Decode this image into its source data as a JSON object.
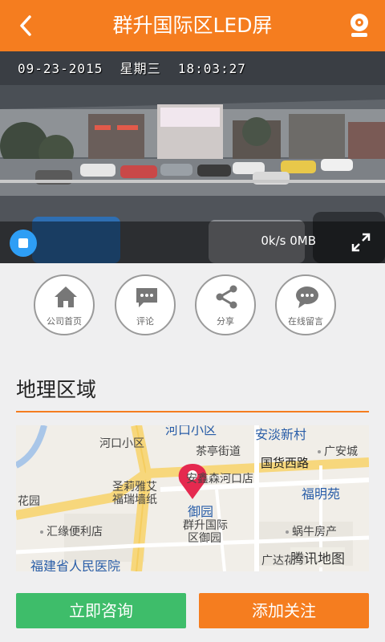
{
  "header": {
    "title": "群升国际区LED屏"
  },
  "video": {
    "timestamp": "09-23-2015  星期三  18:03:27",
    "speed": "0k/s 0MB"
  },
  "actions": [
    {
      "label": "公司首页",
      "icon": "home-icon"
    },
    {
      "label": "评论",
      "icon": "comment-icon"
    },
    {
      "label": "分享",
      "icon": "share-icon"
    },
    {
      "label": "在线留言",
      "icon": "message-icon"
    }
  ],
  "section": {
    "title": "地理区域"
  },
  "map": {
    "labels": {
      "hekou_area_top": "河口小区",
      "anhuai": "安淡新村",
      "hekou_area": "河口小区",
      "chating": "茶亭街道",
      "guangan": "广安城",
      "guohuo": "国货西路",
      "shengli": "圣莉雅艾",
      "fuxiang": "福瑞墙纸",
      "anxin": "安鑫森河口店",
      "fumingyuan": "福明苑",
      "huayuan": "花园",
      "yuyuan": "御园",
      "qunsheng": "群升国际",
      "qunsheng2": "区御园",
      "wonuifang": "蜗牛房产",
      "huijian": "汇缘便利店",
      "guangda": "广达花园",
      "hospital": "福建省人民医院",
      "tencent": "腾讯地图"
    }
  },
  "buttons": {
    "consult": "立即咨询",
    "follow": "添加关注"
  },
  "colors": {
    "accent": "#f57d1f",
    "green": "#3ebd6a",
    "blue": "#2e9ef5"
  }
}
